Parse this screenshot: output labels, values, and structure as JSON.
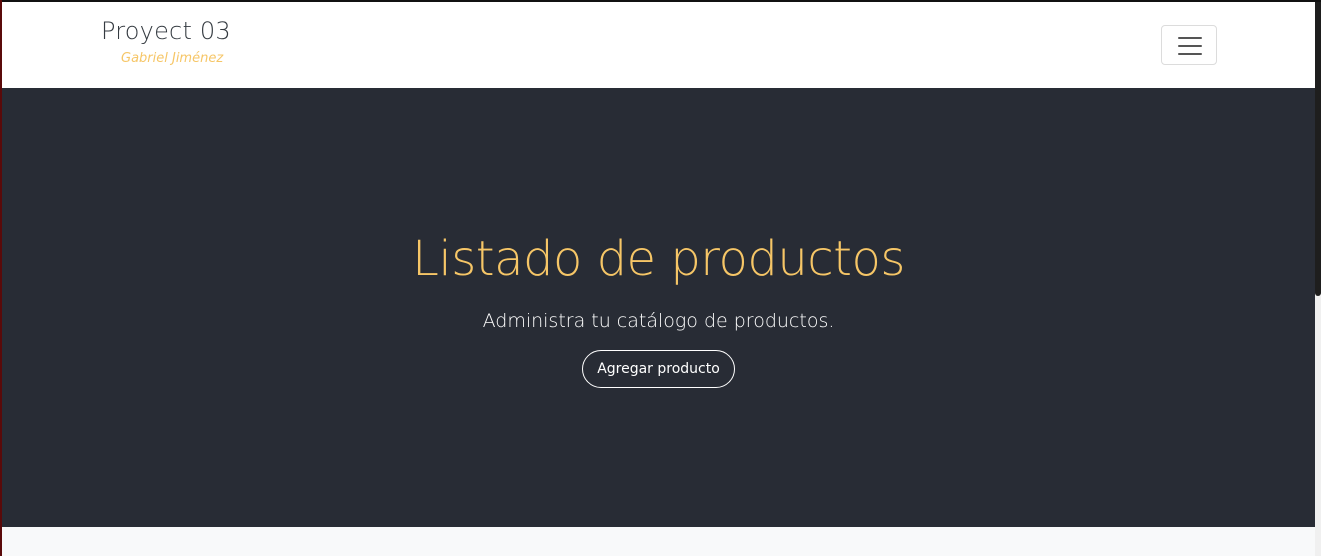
{
  "navbar": {
    "brand_title": "Proyect 03",
    "brand_subtitle": "Gabriel Jiménez",
    "toggler_icon": "hamburger-menu-icon"
  },
  "hero": {
    "title": "Listado de productos",
    "lead": "Administra tu catálogo de productos.",
    "add_button_label": "Agregar producto"
  },
  "colors": {
    "accent": "#f6c667",
    "hero_background": "#282c35",
    "navbar_background": "#ffffff",
    "page_background": "#f8f9fa"
  }
}
